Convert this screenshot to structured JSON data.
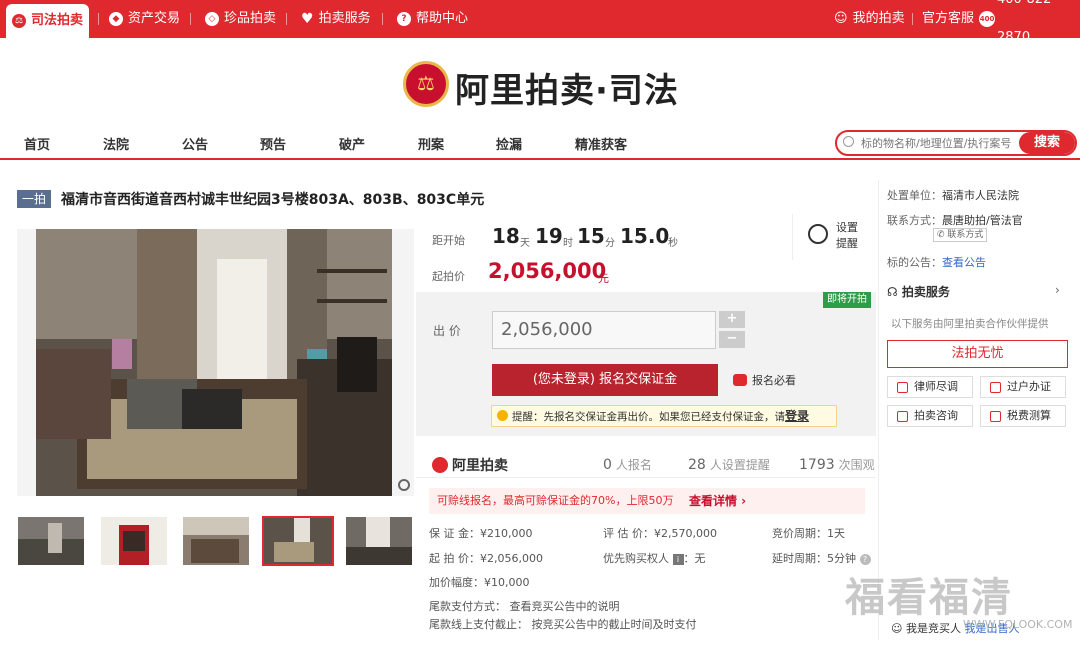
{
  "topbar": {
    "active_tab": "司法拍卖",
    "tabs": [
      "资产交易",
      "珍品拍卖",
      "拍卖服务",
      "帮助中心"
    ],
    "my_auction": "我的拍卖",
    "service": "官方客服",
    "phone": "400-822-2870"
  },
  "logo": {
    "text": "阿里拍卖·司法"
  },
  "nav": {
    "items": [
      "首页",
      "法院",
      "公告",
      "预告",
      "破产",
      "刑案",
      "捡漏",
      "精准获客"
    ],
    "search_placeholder": "标的物名称/地理位置/执行案号",
    "search_button": "搜索"
  },
  "lot": {
    "badge": "一拍",
    "title": "福清市音西街道音西村诚丰世纪园3号楼803A、803B、803C单元"
  },
  "countdown": {
    "label": "距开始",
    "days": "18",
    "days_unit": "天",
    "hours": "19",
    "hours_unit": "时",
    "minutes": "15",
    "minutes_unit": "分",
    "seconds": "15.0",
    "seconds_unit": "秒",
    "reminder": "设置提醒"
  },
  "start_price": {
    "label": "起拍价",
    "value": "2,056,000",
    "unit": "元"
  },
  "bid": {
    "soon_badge": "即将开拍",
    "label": "出 价",
    "value": "2,056,000",
    "plus": "+",
    "minus": "−",
    "deposit_button": "(您未登录) 报名交保证金",
    "must_read": "报名必看",
    "tip_text": "提醒：先报名交保证金再出价。如果您已经支付保证金，请",
    "tip_login": "登录"
  },
  "stats": {
    "brand": "阿里拍卖",
    "signups": "0",
    "signups_label": "人报名",
    "reminders": "28",
    "reminders_label": "人设置提醒",
    "views": "1793",
    "views_label": "次围观"
  },
  "promo": {
    "text": "可赊线报名，最高可赊保证金的70%，上限50万",
    "link": "查看详情 ›"
  },
  "info": {
    "deposit": "保 证 金：¥210,000",
    "estimate": "评 估 价：¥2,570,000",
    "period": "竞价周期：1天",
    "start": "起 拍 价：¥2,056,000",
    "priority": "优先购买权人",
    "priority_val": "无",
    "delay": "延时周期：5分钟",
    "increment": "加价幅度：¥10,000",
    "payment_method": "尾款支付方式：  查看竞买公告中的说明",
    "payment_deadline": "尾款线上支付截止：  按竞买公告中的截止时间及时支付"
  },
  "right": {
    "court_label": "处置单位：",
    "court": "福清市人民法院",
    "contact_label": "联系方式：",
    "contact": "晨唐助拍/管法官",
    "contact_button": "联系方式",
    "notice_label": "标的公告：",
    "notice_link": "查看公告",
    "service_title": "拍卖服务",
    "service_desc": "以下服务由阿里拍卖合作伙伴提供",
    "worry_free": "法拍无忧",
    "lawyer": "律师尽调",
    "transfer": "过户办证",
    "consult": "拍卖咨询",
    "tax": "税费测算",
    "bottom_link": "我是竞买人",
    "bottom_link2": "我是出售人"
  },
  "watermark": {
    "text": "福看福清",
    "url": "WWW.FQLOOK.COM"
  }
}
